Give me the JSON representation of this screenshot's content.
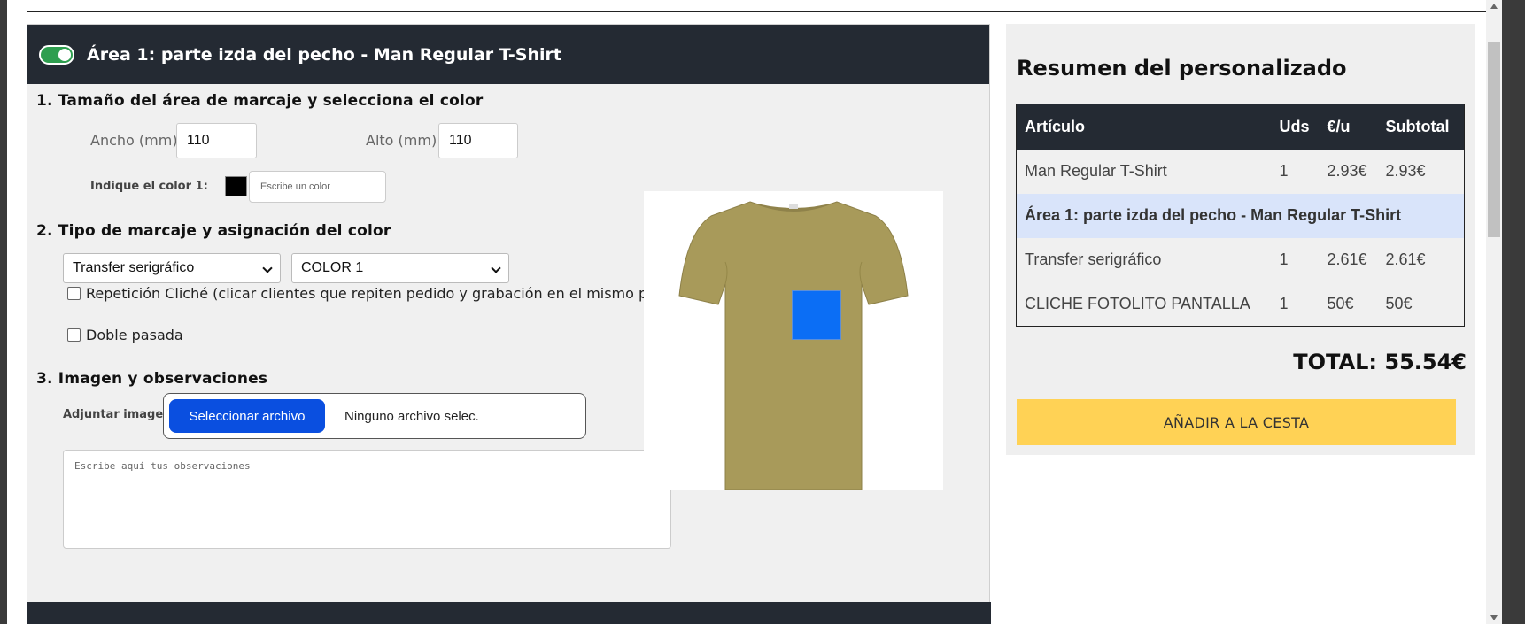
{
  "area": {
    "title": "Área 1: parte izda del pecho - Man Regular T-Shirt",
    "enabled": true
  },
  "section1": {
    "title": "1. Tamaño del área de marcaje y selecciona el color",
    "width_label": "Ancho (mm):",
    "width_value": "110",
    "height_label": "Alto (mm):",
    "height_value": "110",
    "color_label": "Indique el color 1:",
    "color_value": "#000000",
    "color_placeholder": "Escribe un color"
  },
  "section2": {
    "title": "2. Tipo de marcaje y asignación del color",
    "marking_type": "Transfer serigráfico",
    "color_select": "COLOR 1",
    "repeat_cliche_label": "Repetición Cliché (clicar clientes que repiten pedido y grabación en el mismo producto)",
    "double_pass_label": "Doble pasada"
  },
  "section3": {
    "title": "3. Imagen y observaciones",
    "attach_label": "Adjuntar imagen:",
    "file_button": "Seleccionar archivo",
    "file_status": "Ninguno archivo selec.",
    "notes_placeholder": "Escribe aquí tus observaciones"
  },
  "preview": {
    "shirt_color": "#a89a5a",
    "print_color": "#0b6ef5"
  },
  "summary": {
    "title": "Resumen del personalizado",
    "headers": [
      "Artículo",
      "Uds",
      "€/u",
      "Subtotal"
    ],
    "rows": [
      {
        "article": "Man Regular T-Shirt",
        "units": "1",
        "unit_price": "2.93€",
        "subtotal": "2.93€"
      },
      {
        "article": "Área 1: parte izda del pecho - Man Regular T-Shirt"
      },
      {
        "article": "Transfer serigráfico",
        "units": "1",
        "unit_price": "2.61€",
        "subtotal": "2.61€"
      },
      {
        "article": "CLICHE FOTOLITO PANTALLA",
        "units": "1",
        "unit_price": "50€",
        "subtotal": "50€"
      }
    ],
    "total": "TOTAL: 55.54€",
    "add_button": "AÑADIR A LA CESTA"
  },
  "colors": {
    "header_bg": "#242a33",
    "toggle_on": "#2e9e4f",
    "file_button": "#0a4fe0",
    "add_button": "#ffd255",
    "highlight_row": "#d9e4fa"
  }
}
